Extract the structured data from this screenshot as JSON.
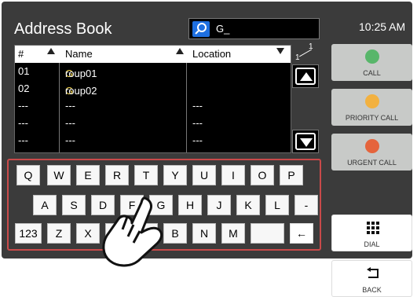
{
  "header": {
    "title": "Address Book",
    "search_text": "G_",
    "time": "10:25 AM"
  },
  "table": {
    "columns": [
      "#",
      "Name",
      "Location"
    ],
    "rows": [
      {
        "num": "01",
        "name": "Group01",
        "location": ""
      },
      {
        "num": "02",
        "name": "Group02",
        "location": ""
      },
      {
        "num": "---",
        "name": "---",
        "location": "---"
      },
      {
        "num": "---",
        "name": "---",
        "location": "---"
      },
      {
        "num": "---",
        "name": "---",
        "location": "---"
      }
    ],
    "page_top": "1",
    "page_bottom": "1"
  },
  "keyboard": {
    "row1": [
      "Q",
      "W",
      "E",
      "R",
      "T",
      "Y",
      "U",
      "I",
      "O",
      "P"
    ],
    "row2": [
      "A",
      "S",
      "D",
      "F",
      "G",
      "H",
      "J",
      "K",
      "L",
      "-"
    ],
    "row3": [
      "123",
      "Z",
      "X",
      "",
      "",
      "B",
      "N",
      "M",
      "",
      "←"
    ]
  },
  "actions": {
    "call": "CALL",
    "priority_call": "PRIORITY CALL",
    "urgent_call": "URGENT CALL",
    "dial": "DIAL",
    "back": "BACK"
  },
  "colors": {
    "background": "#3b3b3b",
    "search_icon": "#1e6fe0",
    "highlight_letter": "#f2d34a",
    "keyboard_outline": "#c94a4a"
  }
}
